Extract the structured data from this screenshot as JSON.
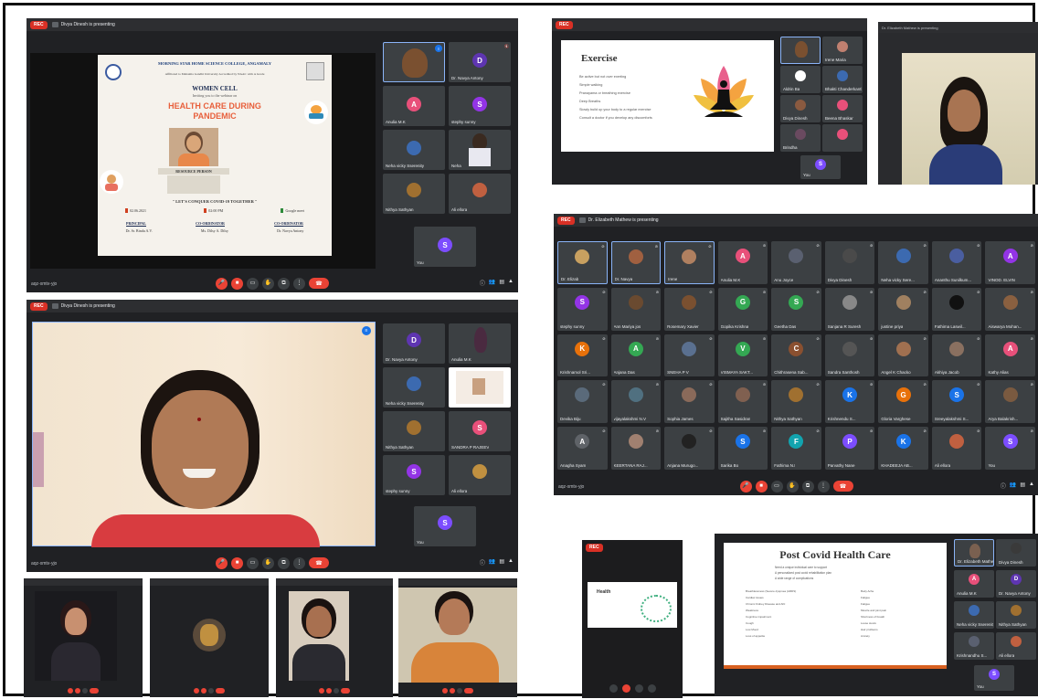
{
  "rec_label": "REC",
  "controls": {
    "end_icon": "☎",
    "mic_icon": "🎤",
    "cam_icon": "■",
    "cc_icon": "▭",
    "hand_icon": "✋",
    "present_icon": "⧉",
    "more_icon": "⋮"
  },
  "w1": {
    "presenting": "Divya Dinesh is presenting",
    "code": "aqz-xmtv-yjo",
    "poster": {
      "college": "MORNING STAR HOME SCIENCE COLLEGE, ANGAMALY",
      "affiliation": "Affiliated to Mahatma Gandhi University Accredited by NAAC with A Grade",
      "cell": "WOMEN CELL",
      "invite": "Inviting you to the webinar on",
      "topic1": "HEALTH CARE DURING",
      "topic2": "PANDEMIC",
      "resource": "RESOURCE PERSON",
      "slogan": "\" LET'S CONQUER COVID-19 TOGETHER \"",
      "date": "02.06.2021",
      "time": "02:00 PM",
      "platform": "Google meet",
      "roles": [
        "PRINCIPAL",
        "CO-ORDINATOR",
        "CO-ORDINATOR"
      ],
      "people": [
        "Dr. Sr. Bindu A.V.",
        "Ms. Dilsy A. Dilsy",
        "Dr. Navya Antony"
      ]
    },
    "tiles": [
      "",
      "Dr. Navya Antony",
      "Anulia M.K",
      "stephy sunny",
      "Neha vicky Sserenity",
      "Neha",
      "Nithya Sathyan",
      "Ali ellora",
      "You"
    ],
    "letters": [
      "",
      "D",
      "A",
      "S",
      "",
      "",
      "",
      "",
      "S"
    ]
  },
  "w2": {
    "slide_title": "Exercise",
    "bullets": [
      "Be active but not over exerting",
      "Simple walking",
      "Pranayama or breathing exercise",
      "Deep Breaths",
      "Slowly build up your body to a regular exercise",
      "Consult a doctor if you develop any discomforts"
    ],
    "tiles": [
      "",
      "Irene Maria",
      "Aldrin Ba",
      "Bhakti Chanderkanth",
      "Divya Dinesh",
      "Beena Bhaskar",
      "Brindha",
      "",
      "You"
    ]
  },
  "w4": {
    "presenting": "Divya Dinesh is presenting",
    "code": "aqz-xmtv-yjo",
    "tiles": [
      "Dr. Navya Antony",
      "Anulia M.K",
      "Neha vicky Sserenity",
      "",
      "Nithya Sathyan",
      "SANDRA P RAJEEV",
      "stephy sunny",
      "Ali ellora",
      "You"
    ],
    "letters": [
      "D",
      "",
      "",
      "",
      "",
      "S",
      "S",
      "",
      "S"
    ]
  },
  "w5": {
    "presenting": "Dr. Elizabeth Mathew is presenting",
    "code": "aqz-xmtv-yjo",
    "grid": [
      {
        "n": "Dr. Elizab",
        "l": "",
        "c": "#c8a060"
      },
      {
        "n": "Dr. Navya",
        "l": "",
        "c": "#a06040"
      },
      {
        "n": "Irene",
        "l": "",
        "c": "#b08060"
      },
      {
        "n": "Anulia M.K",
        "l": "A",
        "c": "#e8507a"
      },
      {
        "n": "Anu Joyce",
        "l": "",
        "c": "#5a6070"
      },
      {
        "n": "Divya Dinesh",
        "l": "",
        "c": "#4a4a4a"
      },
      {
        "n": "Neha vicky Sere...",
        "l": "",
        "c": "#3c6ab0"
      },
      {
        "n": "Ananthu Sunilkum...",
        "l": "",
        "c": "#4a5ea0"
      },
      {
        "n": "VINOD. ELVIN",
        "l": "A",
        "c": "#9334e6"
      },
      {
        "n": "stephy sunny",
        "l": "S",
        "c": "#9334e6"
      },
      {
        "n": "Ann Mariya jos",
        "l": "",
        "c": "#6a4a30"
      },
      {
        "n": "Rosemary Xavier",
        "l": "",
        "c": "#7a5030"
      },
      {
        "n": "Gopika Krishna",
        "l": "G",
        "c": "#34a853"
      },
      {
        "n": "Geetha Das",
        "l": "S",
        "c": "#34a853"
      },
      {
        "n": "Sanjana R Suresh",
        "l": "",
        "c": "#888"
      },
      {
        "n": "justine priya",
        "l": "",
        "c": "#a08060"
      },
      {
        "n": "Fathima Laswil...",
        "l": "",
        "c": "#111"
      },
      {
        "n": "Aiswarya Mohan...",
        "l": "",
        "c": "#8a6040"
      },
      {
        "n": "Krishnamol Sri...",
        "l": "K",
        "c": "#e8710a"
      },
      {
        "n": "Anjana Das",
        "l": "A",
        "c": "#34a853"
      },
      {
        "n": "SNEHA P V",
        "l": "",
        "c": "#5a7090"
      },
      {
        "n": "VISMAYA SAKT...",
        "l": "V",
        "c": "#34a853"
      },
      {
        "n": "Chithrasena Sab...",
        "l": "C",
        "c": "#8a5030"
      },
      {
        "n": "Sandra Santhosh",
        "l": "",
        "c": "#555"
      },
      {
        "n": "Angel K Chacko",
        "l": "",
        "c": "#a07050"
      },
      {
        "n": "Akhiya Jacob",
        "l": "",
        "c": "#8a7060"
      },
      {
        "n": "Kathy Alias",
        "l": "A",
        "c": "#e8507a"
      },
      {
        "n": "Devika Biju",
        "l": "",
        "c": "#5a6a7a"
      },
      {
        "n": "vijayalakshmi N.V",
        "l": "",
        "c": "#507080"
      },
      {
        "n": "Sophia James",
        "l": "",
        "c": "#8a6a5a"
      },
      {
        "n": "Sajitha Sasidran",
        "l": "",
        "c": "#806050"
      },
      {
        "n": "Nithya Sathyan",
        "l": "",
        "c": "#a07030"
      },
      {
        "n": "Krishnendu S...",
        "l": "K",
        "c": "#1a73e8"
      },
      {
        "n": "Gloria Varghese",
        "l": "G",
        "c": "#e8710a"
      },
      {
        "n": "Sreeyalakshmi S...",
        "l": "S",
        "c": "#1a73e8"
      },
      {
        "n": "Arya Balakrish...",
        "l": "",
        "c": "#7a5a40"
      },
      {
        "n": "Anagha Syam",
        "l": "A",
        "c": "#5f6368"
      },
      {
        "n": "KEERTANA RAJ...",
        "l": "",
        "c": "#a08070"
      },
      {
        "n": "Anjana Murugo...",
        "l": "",
        "c": "#222"
      },
      {
        "n": "Sarika Bo",
        "l": "S",
        "c": "#1a73e8"
      },
      {
        "n": "Fathima N.I",
        "l": "F",
        "c": "#12a4af"
      },
      {
        "n": "Parvathy Nane",
        "l": "P",
        "c": "#7c4dff"
      },
      {
        "n": "KHADEEJA AB...",
        "l": "K",
        "c": "#1a73e8"
      },
      {
        "n": "Ali ellora",
        "l": "",
        "c": "#c06040"
      },
      {
        "n": "You",
        "l": "S",
        "c": "#7c4dff"
      }
    ]
  },
  "w7": {
    "slide_title": "Health"
  },
  "w8": {
    "slide_title": "Post Covid Health Care",
    "intro": [
      "Need a unique individual care to support",
      "A personalized post covid rehabilitation plan",
      "A wide range of complications"
    ],
    "left_list": [
      "Breathlessness (Severe dyspnea (ARDS)",
      "Cardiac issues",
      "Chronic Kidney Disease and AKI",
      "Weakness",
      "Cognitive impairment",
      "Cough",
      "Low Mood",
      "Loss of appetite"
    ],
    "right_list": [
      "Body Ache",
      "Fatigue",
      "Fatigue",
      "Muscle and joint pain",
      "Shortness of breath",
      "Loose stools",
      "Hair problems",
      "Anxiety"
    ],
    "tiles": [
      "Dr. Elizabeth Mathew",
      "Divya Dinesh",
      "Anulia M.K",
      "Dr. Navya Antony",
      "Neha vicky Sserenity",
      "Nithya Sathyan",
      "Krishnandhu S...",
      "Ali ellora",
      "You"
    ],
    "letters": [
      "",
      "",
      "A",
      "D",
      "",
      "",
      "",
      "",
      "S"
    ]
  }
}
